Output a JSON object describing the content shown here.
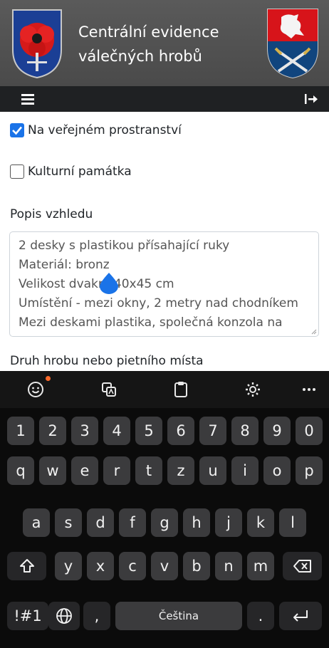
{
  "header": {
    "title_line1": "Centrální evidence",
    "title_line2": "válečných hrobů",
    "left_emblem": "poppy-shield-emblem",
    "right_emblem": "lion-swords-coat-of-arms"
  },
  "toolbar": {
    "menu_icon": "hamburger-icon",
    "logout_icon": "logout-icon"
  },
  "form": {
    "public_space_label": "Na veřejném prostranství",
    "public_space_checked": true,
    "cultural_monument_label": "Kulturní památka",
    "cultural_monument_checked": false,
    "description_label": "Popis vzhledu",
    "description_lines": [
      "2 desky s plastikou přísahající ruky",
      "Materiál: bronz",
      "Velikost dvakr",
      "40x45 cm",
      "Umístění - mezi okny, 2 metry nad chodníkem",
      "Mezi deskami plastika, společná konzola na"
    ],
    "grave_type_label": "Druh hrobu nebo pietního místa"
  },
  "keyboard": {
    "toolbar_icons": [
      "emoji-icon",
      "clipboard-translate-icon",
      "clipboard-icon",
      "settings-icon",
      "more-icon"
    ],
    "row_numbers": [
      "1",
      "2",
      "3",
      "4",
      "5",
      "6",
      "7",
      "8",
      "9",
      "0"
    ],
    "row_top": [
      "q",
      "w",
      "e",
      "r",
      "t",
      "z",
      "u",
      "i",
      "o",
      "p"
    ],
    "row_home": [
      "a",
      "s",
      "d",
      "f",
      "g",
      "h",
      "j",
      "k",
      "l"
    ],
    "row_bottom": [
      "y",
      "x",
      "c",
      "v",
      "b",
      "n",
      "m"
    ],
    "symbols_label": "!#1",
    "comma_label": ",",
    "space_label": "Čeština",
    "period_label": ".",
    "colors": {
      "accent": "#1a73e8",
      "key": "#3b3b3d",
      "background": "#0b0b0b"
    }
  }
}
